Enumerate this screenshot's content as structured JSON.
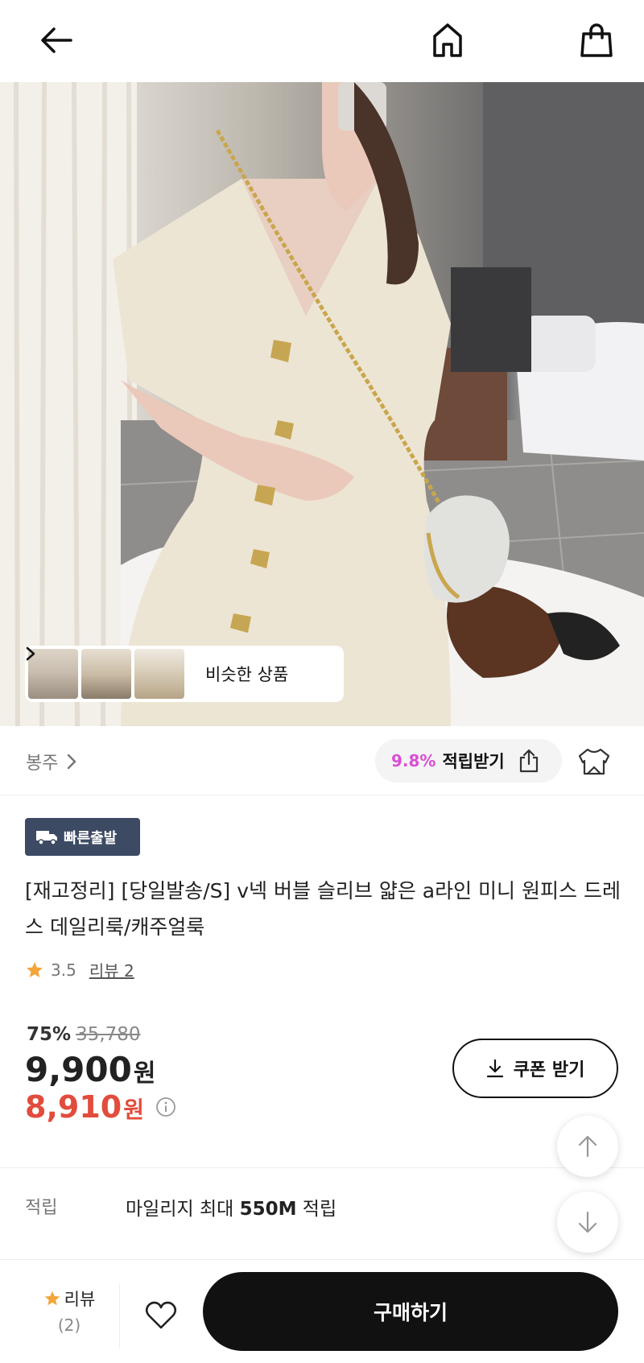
{
  "header": {
    "back_icon": "arrow-left-icon",
    "home_icon": "home-icon",
    "bag_icon": "shopping-bag-icon"
  },
  "similar": {
    "label": "비슷한 상품"
  },
  "seller": {
    "name": "봉주"
  },
  "points": {
    "percent": "9.8%",
    "label": "적립받기"
  },
  "badge": {
    "label": "빠른출발"
  },
  "product": {
    "title": "[재고정리] [당일발송/S] v넥 버블 슬리브 얇은 a라인 미니 원피스 드레스 데일리룩/캐주얼룩",
    "rating": "3.5",
    "review_link": "리뷰 2"
  },
  "price": {
    "discount": "75%",
    "original": "35,780",
    "sale": "9,900",
    "member": "8,910",
    "currency": "원"
  },
  "coupon": {
    "label": "쿠폰 받기"
  },
  "mileage": {
    "label": "적립",
    "text_prefix": "마일리지 최대 ",
    "amount": "550M",
    "text_suffix": " 적립"
  },
  "bottom_bar": {
    "review_label": "리뷰",
    "review_count": "(2)",
    "buy_label": "구매하기"
  },
  "colors": {
    "points_accent": "#d94fd3",
    "member_price": "#e24c3c",
    "badge_bg": "#3d4a63",
    "star": "#f2a63a"
  }
}
